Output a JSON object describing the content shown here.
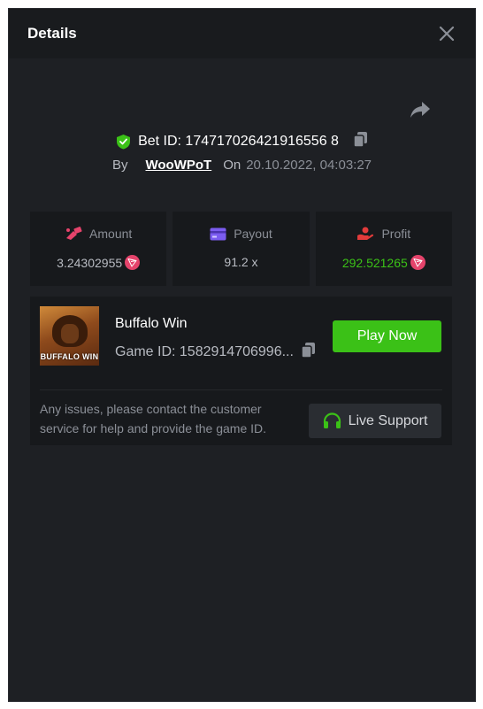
{
  "header": {
    "title": "Details"
  },
  "bet": {
    "id_text": "Bet ID: 174717026421916556 8",
    "by_label": "By",
    "username": "WooWPoT",
    "on_label": "On",
    "datetime": "20.10.2022, 04:03:27"
  },
  "stats": {
    "amount": {
      "label": "Amount",
      "value": "3.24302955"
    },
    "payout": {
      "label": "Payout",
      "value": "91.2 x"
    },
    "profit": {
      "label": "Profit",
      "value": "292.521265"
    }
  },
  "game": {
    "thumb_label": "BUFFALO WIN",
    "name": "Buffalo Win",
    "id_text": "Game ID: 1582914706996...",
    "play_label": "Play Now"
  },
  "support": {
    "message": "Any issues, please contact the customer service for help and provide the game ID.",
    "button_label": "Live Support"
  },
  "colors": {
    "background": "#1e2024",
    "card": "#17191c",
    "accent_green": "#3bc117",
    "coin_pink": "#e5436b",
    "payout_purple": "#7b5cf0",
    "profit_red": "#e23b3b"
  },
  "icons": [
    "close-icon",
    "share-icon",
    "shield-check-icon",
    "copy-icon",
    "amount-icon",
    "card-icon",
    "profit-hand-icon",
    "tron-coin-icon",
    "headset-icon"
  ]
}
